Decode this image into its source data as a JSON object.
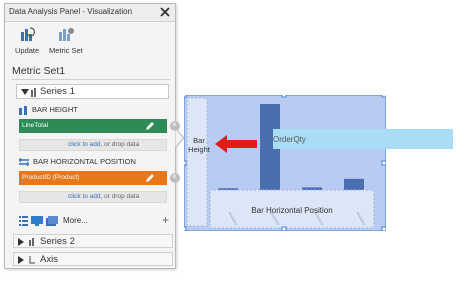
{
  "panel": {
    "title": "Data Analysis Panel - Visualization",
    "toolbar": {
      "update_label": "Update",
      "metric_set_label": "Metric Set"
    },
    "metric_set_title": "Metric Set1",
    "series1": {
      "label": "Series 1"
    },
    "bar_height": {
      "header": "BAR HEIGHT",
      "field": "LineTotal",
      "field_color": "#2e8b57",
      "dropzone_link": "click to add",
      "dropzone_rest": ", or drop data"
    },
    "bar_hpos": {
      "header": "BAR HORIZONTAL POSITION",
      "field": "ProductID (Product)",
      "field_color": "#e8761a",
      "dropzone_link": "click to add",
      "dropzone_rest": ", or drop data"
    },
    "more_label": "More...",
    "series2": {
      "label": "Series 2"
    },
    "axis": {
      "label": "Axis"
    }
  },
  "chart": {
    "bar_height_label_line1": "Bar",
    "bar_height_label_line2": "Height",
    "orderqty_label": "OrderQty",
    "hpos_label": "Bar Horizontal Position",
    "bar_values": [
      0.02,
      1.0,
      0.03,
      0.13
    ],
    "accent_color": "#4a6fb0",
    "arrow_color": "#e21b1b"
  }
}
